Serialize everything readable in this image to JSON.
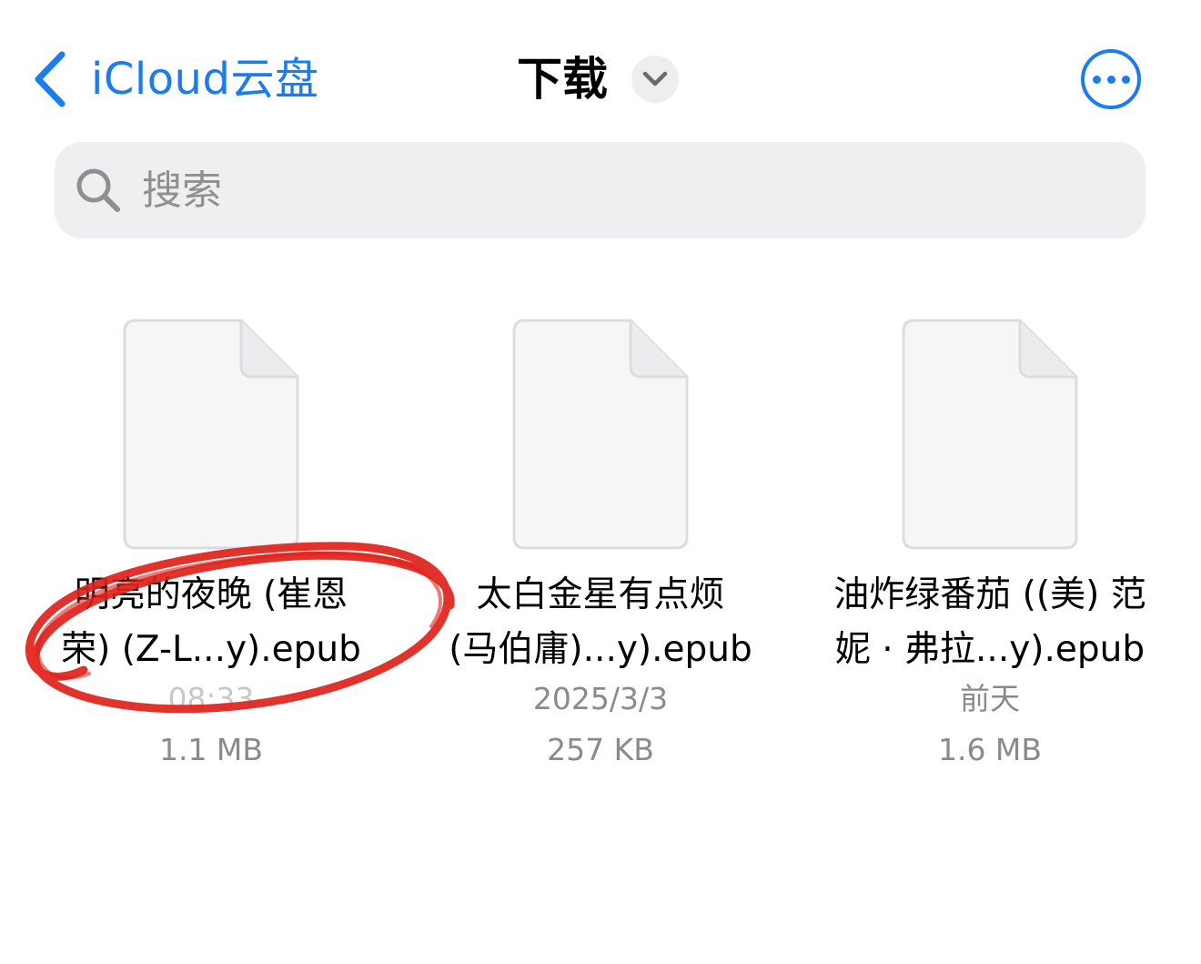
{
  "nav": {
    "back_label": "iCloud云盘",
    "title": "下载",
    "back_icon": "chevron-left-icon",
    "title_menu_icon": "chevron-down-icon",
    "more_icon": "ellipsis-circle-icon"
  },
  "search": {
    "placeholder": "搜索",
    "icon": "search-icon"
  },
  "files": [
    {
      "name_line1": "明亮的夜晚 (崔恩",
      "name_line2": "荣) (Z-L...y).epub",
      "date": "08:33",
      "size": "1.1 MB"
    },
    {
      "name_line1": "太白金星有点烦",
      "name_line2": "(马伯庸)...y).epub",
      "date": "2025/3/3",
      "size": "257 KB"
    },
    {
      "name_line1": "油炸绿番茄 ((美) 范",
      "name_line2": "妮 · 弗拉...y).epub",
      "date": "前天",
      "size": "1.6 MB"
    }
  ],
  "colors": {
    "accent": "#1a7cf0",
    "annotation": "#e0211a",
    "secondary_text": "#8a8a8e"
  }
}
